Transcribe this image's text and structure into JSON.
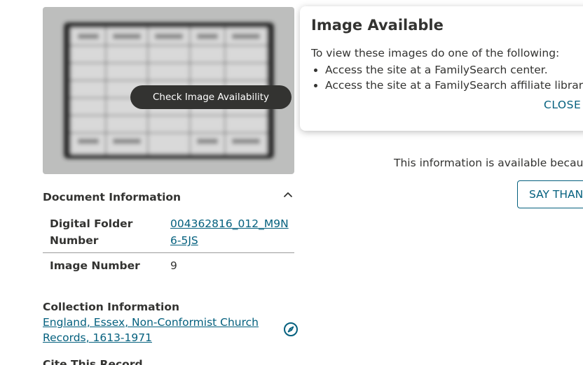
{
  "thumbnail": {
    "check_button_label": "Check Image Availability"
  },
  "document_info": {
    "heading": "Document Information",
    "rows": [
      {
        "label": "Digital Folder Number",
        "value": "004362816_012_M9N6-5JS"
      },
      {
        "label": "Image Number",
        "value": "9"
      }
    ]
  },
  "collection_info": {
    "heading": "Collection Information",
    "link_text": "England, Essex, Non-Conformist Church Records, 1613-1971",
    "next_heading": "Cite This Record"
  },
  "popup": {
    "title": "Image Available",
    "intro": "To view these images do one of the following:",
    "items": [
      "Access the site at a FamilySearch center.",
      "Access the site at a FamilySearch affiliate library."
    ],
    "close_label": "CLOSE"
  },
  "availability_text": "This information is available because",
  "say_thanks_label": "SAY THANKS",
  "colors": {
    "link": "#04607e",
    "text": "#333331",
    "button_dark": "#333331",
    "thumbnail_bg": "#bdbebd"
  },
  "icons": {
    "collapse": "chevron-up-icon",
    "collection": "compass-icon"
  }
}
